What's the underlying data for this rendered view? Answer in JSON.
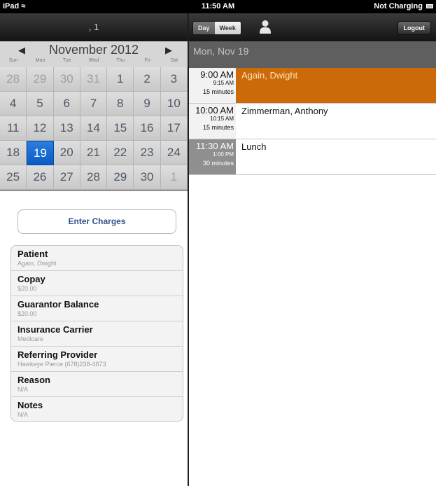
{
  "status_bar": {
    "device": "iPad",
    "time": "11:50 AM",
    "charging": "Not Charging"
  },
  "left_header": {
    "title": ", 1"
  },
  "calendar": {
    "month_title": "November 2012",
    "prev_label": "◀",
    "next_label": "▶",
    "weekdays": [
      "Sun",
      "Mon",
      "Tue",
      "Wed",
      "Thu",
      "Fri",
      "Sat"
    ],
    "weeks": [
      [
        "28",
        "29",
        "30",
        "31",
        "1",
        "2",
        "3"
      ],
      [
        "4",
        "5",
        "6",
        "7",
        "8",
        "9",
        "10"
      ],
      [
        "11",
        "12",
        "13",
        "14",
        "15",
        "16",
        "17"
      ],
      [
        "18",
        "19",
        "20",
        "21",
        "22",
        "23",
        "24"
      ],
      [
        "25",
        "26",
        "27",
        "28",
        "29",
        "30",
        "1"
      ]
    ],
    "selected_day": "19"
  },
  "enter_charges_label": "Enter Charges",
  "details": [
    {
      "label": "Patient",
      "value": "Again, Dwight"
    },
    {
      "label": "Copay",
      "value": "$20.00"
    },
    {
      "label": "Guarantor Balance",
      "value": "$20.00"
    },
    {
      "label": "Insurance Carrier",
      "value": "Medicare"
    },
    {
      "label": "Referring Provider",
      "value": "Hawkeye Pierce (678)238-4873"
    },
    {
      "label": "Reason",
      "value": "N/A"
    },
    {
      "label": "Notes",
      "value": "N/A"
    }
  ],
  "toolbar": {
    "day_label": "Day",
    "week_label": "Week",
    "user_icon": "person-icon",
    "logout_label": "Logout"
  },
  "schedule": {
    "date_label": "Mon, Nov 19",
    "appointments": [
      {
        "start": "9:00 AM",
        "end": "9:15 AM",
        "duration": "15 minutes",
        "name": "Again, Dwight"
      },
      {
        "start": "10:00 AM",
        "end": "10:15 AM",
        "duration": "15 minutes",
        "name": "Zimmerman, Anthony"
      },
      {
        "start": "11:30 AM",
        "end": "1:00 PM",
        "duration": "30 minutes",
        "name": "Lunch"
      }
    ]
  },
  "colors": {
    "selected_appointment": "#cc6a0a",
    "selected_day": "#1565d8"
  }
}
